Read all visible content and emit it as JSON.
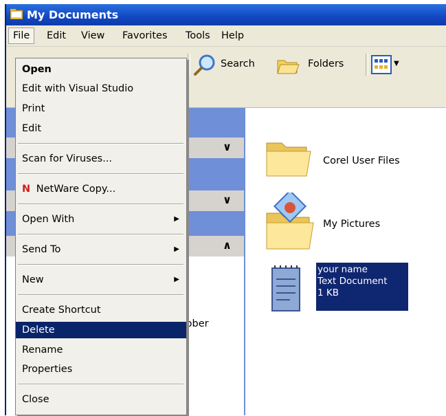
{
  "window": {
    "title": "My Documents"
  },
  "menubar": [
    "File",
    "Edit",
    "View",
    "Favorites",
    "Tools",
    "Help"
  ],
  "toolbar": {
    "search_label": "Search",
    "folders_label": "Folders"
  },
  "context_menu": {
    "items": [
      {
        "label": "Open",
        "bold": true
      },
      {
        "label": "Edit with Visual Studio"
      },
      {
        "label": "Print"
      },
      {
        "label": "Edit"
      },
      {
        "label": "Scan for Viruses..."
      },
      {
        "label": "NetWare Copy..."
      },
      {
        "label": "Open With",
        "submenu": true
      },
      {
        "label": "Send To",
        "submenu": true
      },
      {
        "label": "New",
        "submenu": true
      },
      {
        "label": "Create Shortcut"
      },
      {
        "label": "Delete",
        "highlighted": true
      },
      {
        "label": "Rename"
      },
      {
        "label": "Properties"
      },
      {
        "label": "Close"
      }
    ],
    "netware_glyph": "N"
  },
  "task_pane": {
    "partial_text": "tober"
  },
  "files": [
    {
      "name": "Corel User Files",
      "icon": "folder-icon"
    },
    {
      "name": "My Pictures",
      "icon": "pictures-folder-icon"
    },
    {
      "name": "your name",
      "type": "Text Document",
      "size": "1 KB",
      "icon": "text-document-icon"
    }
  ],
  "colors": {
    "title_bar": "#1248c2",
    "highlight": "#0a246a",
    "menu_bg": "#ece9d8"
  }
}
